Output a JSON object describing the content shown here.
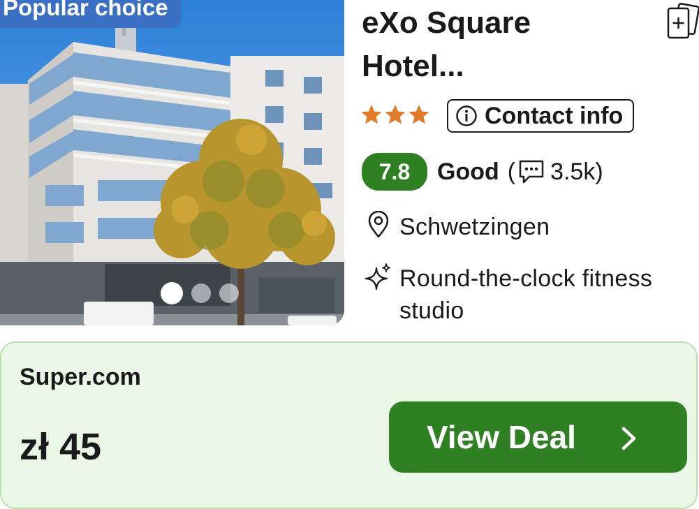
{
  "listing": {
    "badge": "Popular choice",
    "title_line1": "eXo Square",
    "title_line2": "Hotel...",
    "stars": 3,
    "contact_label": "Contact info",
    "rating_score": "7.8",
    "rating_label": "Good",
    "paren_open": "(",
    "review_count": "3.5k)",
    "location": "Schwetzingen",
    "amenity_line1": "Round-the-clock fitness",
    "amenity_line2": "studio",
    "photo_count": 3,
    "active_photo": 1
  },
  "deal": {
    "provider": "Super.com",
    "price": "zł 45",
    "button_label": "View Deal"
  },
  "colors": {
    "badge_bg": "#3a6fc4",
    "star": "#e07b2a",
    "rating_bg": "#2f8023",
    "deal_bg": "#eaf7e7",
    "cta_bg": "#2f8023"
  },
  "icons": {
    "save": "add-to-collection-icon",
    "info": "info-circle-icon",
    "reviews": "speech-bubble-icon",
    "location": "map-pin-icon",
    "amenity": "sparkle-icon",
    "cta": "chevron-right-icon"
  }
}
